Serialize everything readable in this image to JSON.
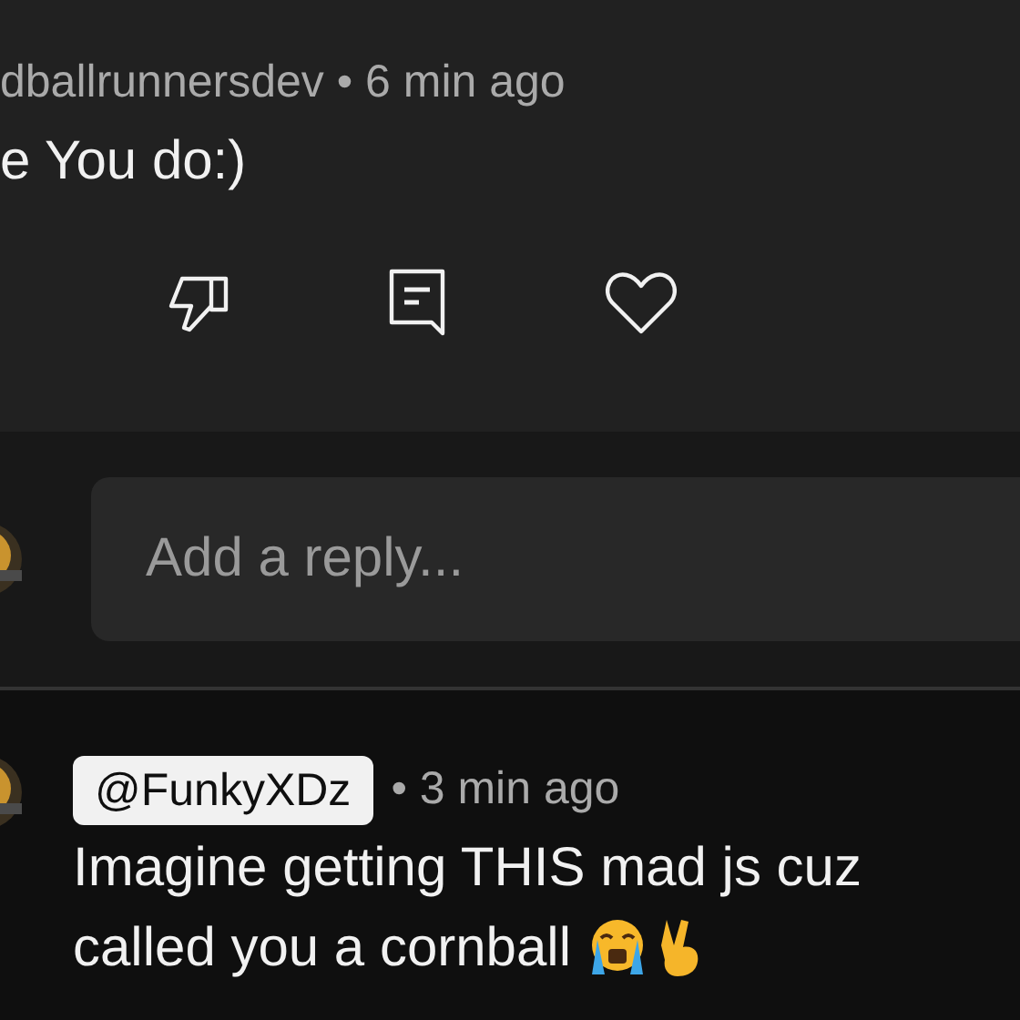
{
  "comment": {
    "author_meta": "dballrunnersdev • 6 min ago",
    "body": "e You do:)"
  },
  "actions": [
    {
      "kind": "dislike"
    },
    {
      "kind": "reply"
    },
    {
      "kind": "heart"
    }
  ],
  "reply_field": {
    "placeholder": "Add a reply..."
  },
  "reply": {
    "mention": "@FunkyXDz",
    "time": "• 3 min ago",
    "body_lines": [
      "Imagine getting THIS mad js cuz",
      "called you a cornball"
    ],
    "emojis": [
      {
        "kind": "crying"
      },
      {
        "kind": "victory"
      }
    ]
  }
}
